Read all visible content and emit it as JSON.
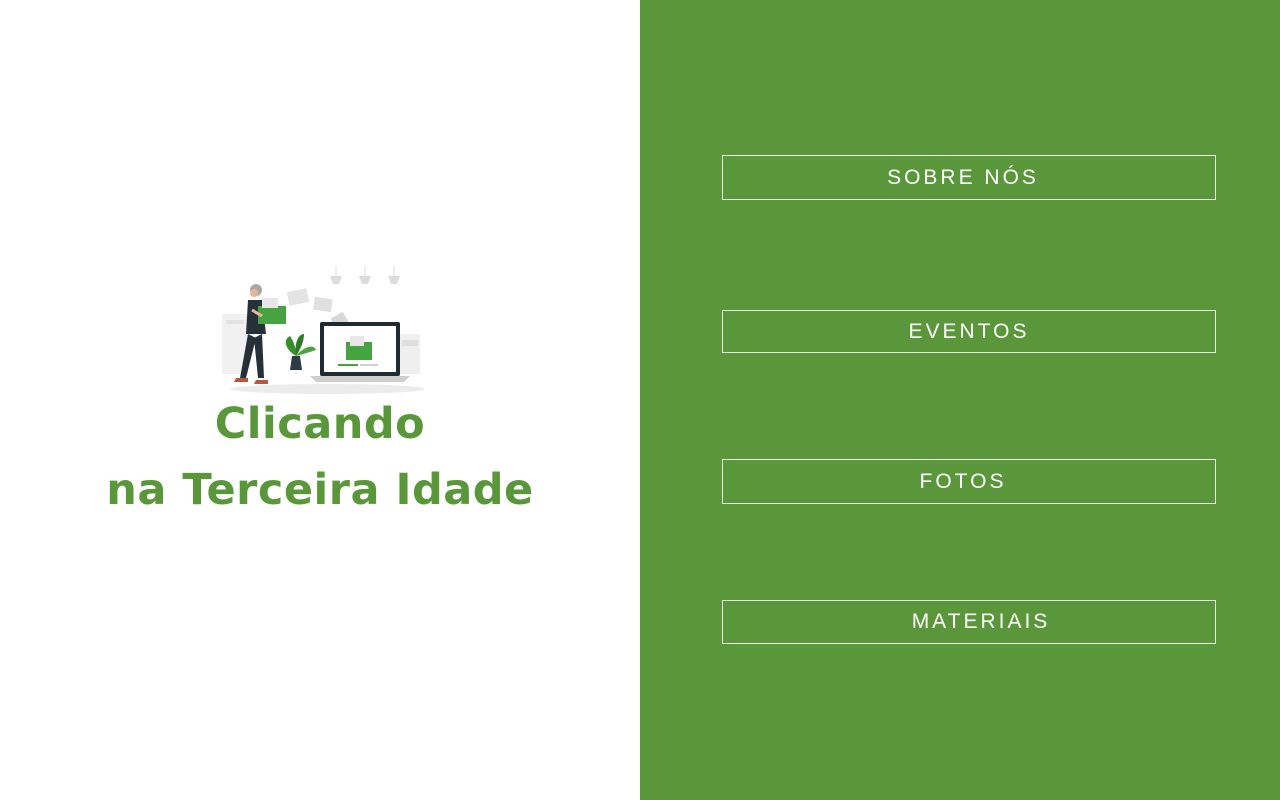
{
  "hero": {
    "title_line1": "Clicando",
    "title_line2": "na Terceira Idade",
    "illustration_icon": "person-uploading-files-illustration"
  },
  "nav": {
    "items": [
      {
        "label": "SOBRE NÓS"
      },
      {
        "label": "EVENTOS"
      },
      {
        "label": "FOTOS"
      },
      {
        "label": "MATERIAIS"
      }
    ]
  },
  "colors": {
    "brand_green": "#5a973a",
    "background": "#ffffff",
    "button_border": "#e7efe2",
    "button_text": "#ffffff"
  }
}
